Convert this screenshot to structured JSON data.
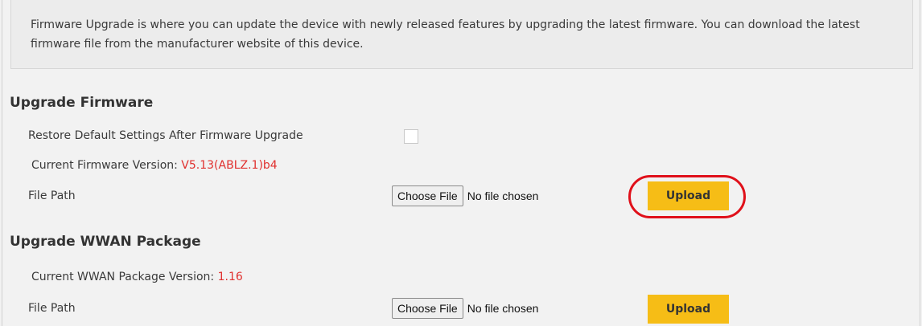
{
  "info": {
    "text": "Firmware Upgrade is where you can update the device with newly released features by upgrading the latest firmware. You can download the latest firmware file from the manufacturer website of this device."
  },
  "firmware": {
    "title": "Upgrade Firmware",
    "restore_label": "Restore Default Settings After Firmware Upgrade",
    "restore_checked": false,
    "current_version_label": "Current Firmware Version: ",
    "current_version_value": "V5.13(ABLZ.1)b4",
    "file_path_label": "File Path",
    "choose_file_label": "Choose File",
    "no_file_text": "No file chosen",
    "upload_label": "Upload"
  },
  "wwan": {
    "title": "Upgrade WWAN Package",
    "current_version_label": "Current WWAN Package Version: ",
    "current_version_value": "1.16",
    "file_path_label": "File Path",
    "choose_file_label": "Choose File",
    "no_file_text": "No file chosen",
    "upload_label": "Upload"
  },
  "colors": {
    "accent": "#f6bd16",
    "version_text": "#e0302e",
    "highlight_ring": "#e0101a"
  }
}
